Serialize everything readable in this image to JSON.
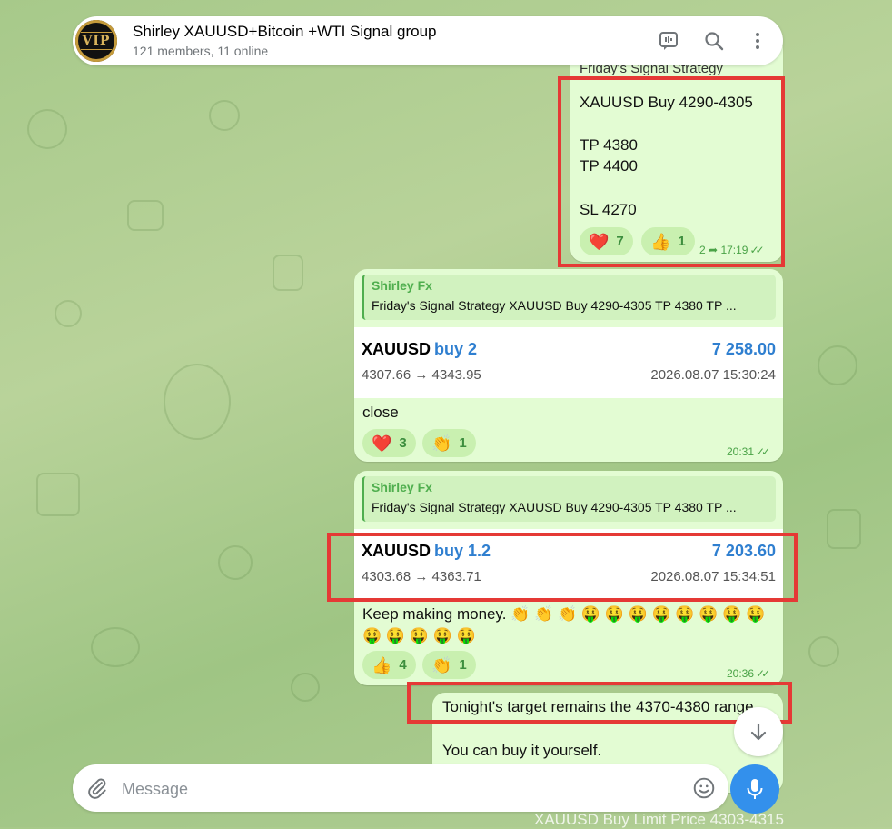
{
  "header": {
    "avatar_text": "VIP",
    "title": "Shirley XAUUSD+Bitcoin +WTI Signal group",
    "subtitle": "121 members, 11 online",
    "icons": [
      "voice-chat-icon",
      "search-icon",
      "more-vert-icon"
    ]
  },
  "msg1": {
    "cut_text": "Friday's Signal Strategy",
    "lines": [
      "XAUUSD Buy 4290-4305",
      "TP 4380",
      "TP 4400",
      "SL 4270"
    ],
    "reactions": [
      {
        "emoji": "❤️",
        "count": "7"
      },
      {
        "emoji": "👍",
        "count": "1"
      }
    ],
    "forwards": "2",
    "time": "17:19"
  },
  "msg2": {
    "reply_name": "Shirley Fx",
    "reply_text": "Friday's Signal Strategy XAUUSD Buy 4290-4305 TP 4380 TP ...",
    "symbol": "XAUUSD",
    "direction": "buy 2",
    "profit": "7 258.00",
    "prices": "4307.66 → 4343.95",
    "date": "2026.08.07 15:30:24",
    "text": "close",
    "reactions": [
      {
        "emoji": "❤️",
        "count": "3"
      },
      {
        "emoji": "👏",
        "count": "1"
      }
    ],
    "time": "20:31"
  },
  "msg3": {
    "reply_name": "Shirley Fx",
    "reply_text": "Friday's Signal Strategy XAUUSD Buy 4290-4305 TP 4380 TP ...",
    "symbol": "XAUUSD",
    "direction": "buy 1.2",
    "profit": "7 203.60",
    "prices": "4303.68 → 4363.71",
    "date": "2026.08.07 15:34:51",
    "text_line1": "Keep making money.  👏 👏 👏 🤑 🤑 🤑 🤑 🤑 🤑 🤑 🤑",
    "text_line2": "🤑 🤑 🤑 🤑 🤑",
    "reactions": [
      {
        "emoji": "👍",
        "count": "4"
      },
      {
        "emoji": "👏",
        "count": "1"
      }
    ],
    "time": "20:36"
  },
  "msg4": {
    "line1": "Tonight's target remains the 4370-4380 range.",
    "line2": "You can buy it yourself."
  },
  "input": {
    "placeholder": "Message"
  },
  "bottom_preview": "XAUUSD Buy Limit Price 4303-4315",
  "colors": {
    "bubble": "#e3fcd3",
    "accent": "#3390ec",
    "highlight": "#e53935",
    "reaction": "#c9f0b0"
  }
}
